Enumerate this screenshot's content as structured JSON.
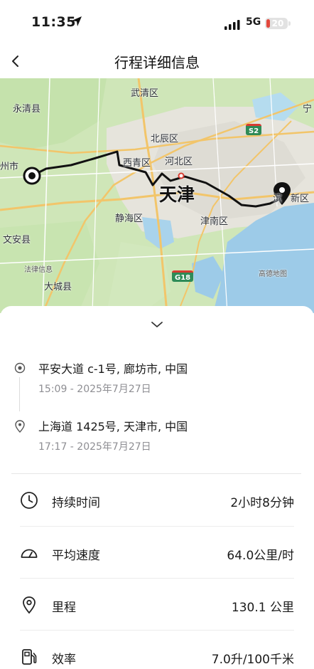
{
  "status": {
    "time": "11:35",
    "network": "5G",
    "battery": "20"
  },
  "nav": {
    "title": "行程详细信息"
  },
  "map": {
    "labels": {
      "wuqing": "武清区",
      "yongqing": "永清县",
      "ning": "宁",
      "beichen": "北辰区",
      "xiqing": "西青区",
      "hebei": "河北区",
      "tianjin": "天津",
      "jinghai": "静海区",
      "jinnan": "津南区",
      "xinqu": "新区",
      "bin": "滨",
      "zhoushi": "州市",
      "wenan": "文安县",
      "dacheng": "大城县",
      "watermark_left": "法律信息",
      "watermark_right": "高德地图"
    },
    "shields": {
      "s2": "S2",
      "g18": "G18"
    }
  },
  "trip": {
    "start": {
      "address": "平安大道 c-1号, 廊坊市, 中国",
      "time": "15:09 - 2025年7月27日"
    },
    "end": {
      "address": "上海道 1425号, 天津市, 中国",
      "time": "17:17 - 2025年7月27日"
    }
  },
  "stats": [
    {
      "label": "持续时间",
      "value": "2小时8分钟",
      "icon": "clock-icon"
    },
    {
      "label": "平均速度",
      "value": "64.0公里/时",
      "icon": "speedometer-icon"
    },
    {
      "label": "里程",
      "value": "130.1 公里",
      "icon": "location-pin-icon"
    },
    {
      "label": "效率",
      "value": "7.0升/100千米",
      "icon": "fuel-pump-icon"
    }
  ]
}
